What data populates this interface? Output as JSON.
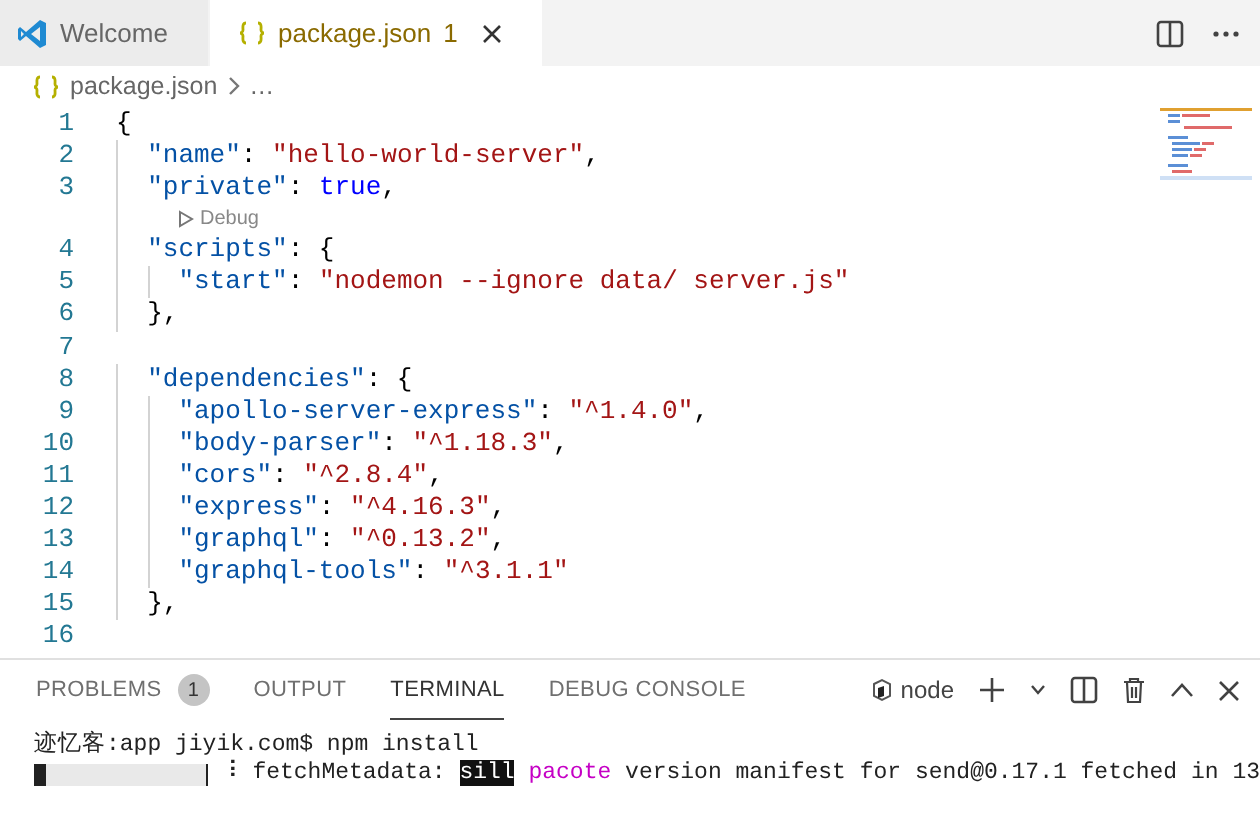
{
  "tabs": [
    {
      "label": "Welcome",
      "kind": "welcome",
      "selected": false,
      "has_problems": false
    },
    {
      "label": "package.json",
      "kind": "json",
      "problem_count": "1",
      "selected": true,
      "has_problems": true
    }
  ],
  "breadcrumb": {
    "file": "package.json",
    "rest": "…"
  },
  "editor": {
    "lines": [
      {
        "number": "1",
        "tokens": [
          {
            "kind": "punct",
            "text": "{"
          }
        ]
      },
      {
        "number": "2",
        "tokens": [
          {
            "kind": "key",
            "text": "  \"name\""
          },
          {
            "kind": "punct",
            "text": ": "
          },
          {
            "kind": "string",
            "text": "\"hello-world-server\""
          },
          {
            "kind": "punct",
            "text": ","
          }
        ]
      },
      {
        "number": "3",
        "tokens": [
          {
            "kind": "key",
            "text": "  \"private\""
          },
          {
            "kind": "punct",
            "text": ": "
          },
          {
            "kind": "bool",
            "text": "true"
          },
          {
            "kind": "punct",
            "text": ","
          }
        ],
        "codelens": "Debug"
      },
      {
        "number": "4",
        "tokens": [
          {
            "kind": "key",
            "text": "  \"scripts\""
          },
          {
            "kind": "punct",
            "text": ": {"
          }
        ]
      },
      {
        "number": "5",
        "tokens": [
          {
            "kind": "key",
            "text": "    \"start\""
          },
          {
            "kind": "punct",
            "text": ": "
          },
          {
            "kind": "string",
            "text": "\"nodemon --ignore data/ server.js\""
          }
        ]
      },
      {
        "number": "6",
        "tokens": [
          {
            "kind": "punct",
            "text": "  },"
          }
        ]
      },
      {
        "number": "7"
      },
      {
        "number": "8",
        "tokens": [
          {
            "kind": "key",
            "text": "  \"dependencies\""
          },
          {
            "kind": "punct",
            "text": ": {"
          }
        ]
      },
      {
        "number": "9",
        "tokens": [
          {
            "kind": "key",
            "text": "    \"apollo-server-express\""
          },
          {
            "kind": "punct",
            "text": ": "
          },
          {
            "kind": "string",
            "text": "\"^1.4.0\""
          },
          {
            "kind": "punct",
            "text": ","
          }
        ]
      },
      {
        "number": "10",
        "tokens": [
          {
            "kind": "key",
            "text": "    \"body-parser\""
          },
          {
            "kind": "punct",
            "text": ": "
          },
          {
            "kind": "string",
            "text": "\"^1.18.3\""
          },
          {
            "kind": "punct",
            "text": ","
          }
        ]
      },
      {
        "number": "11",
        "tokens": [
          {
            "kind": "key",
            "text": "    \"cors\""
          },
          {
            "kind": "punct",
            "text": ": "
          },
          {
            "kind": "string",
            "text": "\"^2.8.4\""
          },
          {
            "kind": "punct",
            "text": ","
          }
        ]
      },
      {
        "number": "12",
        "tokens": [
          {
            "kind": "key",
            "text": "    \"express\""
          },
          {
            "kind": "punct",
            "text": ": "
          },
          {
            "kind": "string",
            "text": "\"^4.16.3\""
          },
          {
            "kind": "punct",
            "text": ","
          }
        ]
      },
      {
        "number": "13",
        "tokens": [
          {
            "kind": "key",
            "text": "    \"graphql\""
          },
          {
            "kind": "punct",
            "text": ": "
          },
          {
            "kind": "string",
            "text": "\"^0.13.2\""
          },
          {
            "kind": "punct",
            "text": ","
          }
        ]
      },
      {
        "number": "14",
        "tokens": [
          {
            "kind": "key",
            "text": "    \"graphql-tools\""
          },
          {
            "kind": "punct",
            "text": ": "
          },
          {
            "kind": "string",
            "text": "\"^3.1.1\""
          }
        ]
      },
      {
        "number": "15",
        "tokens": [
          {
            "kind": "punct",
            "text": "  },"
          }
        ]
      },
      {
        "number": "16"
      }
    ]
  },
  "panel": {
    "tabs": [
      {
        "label": "PROBLEMS",
        "badge": "1",
        "selected": false
      },
      {
        "label": "OUTPUT",
        "selected": false
      },
      {
        "label": "TERMINAL",
        "selected": true
      },
      {
        "label": "DEBUG CONSOLE",
        "selected": false
      }
    ],
    "terminal_name": "node",
    "terminal": [
      {
        "segments": [
          {
            "kind": "plain",
            "text": "迹忆客:app jiyik.com$ npm install"
          }
        ]
      },
      {
        "progress": {
          "level": 0.05
        },
        "segments": [
          {
            "kind": "plain",
            "text": "⠸ fetchMetadata: "
          },
          {
            "kind": "highlight",
            "text": "sill"
          },
          {
            "kind": "magenta",
            "text": " pacote"
          },
          {
            "kind": "plain",
            "text": " version manifest for send@0.17.1 fetched in 13"
          }
        ]
      }
    ]
  }
}
